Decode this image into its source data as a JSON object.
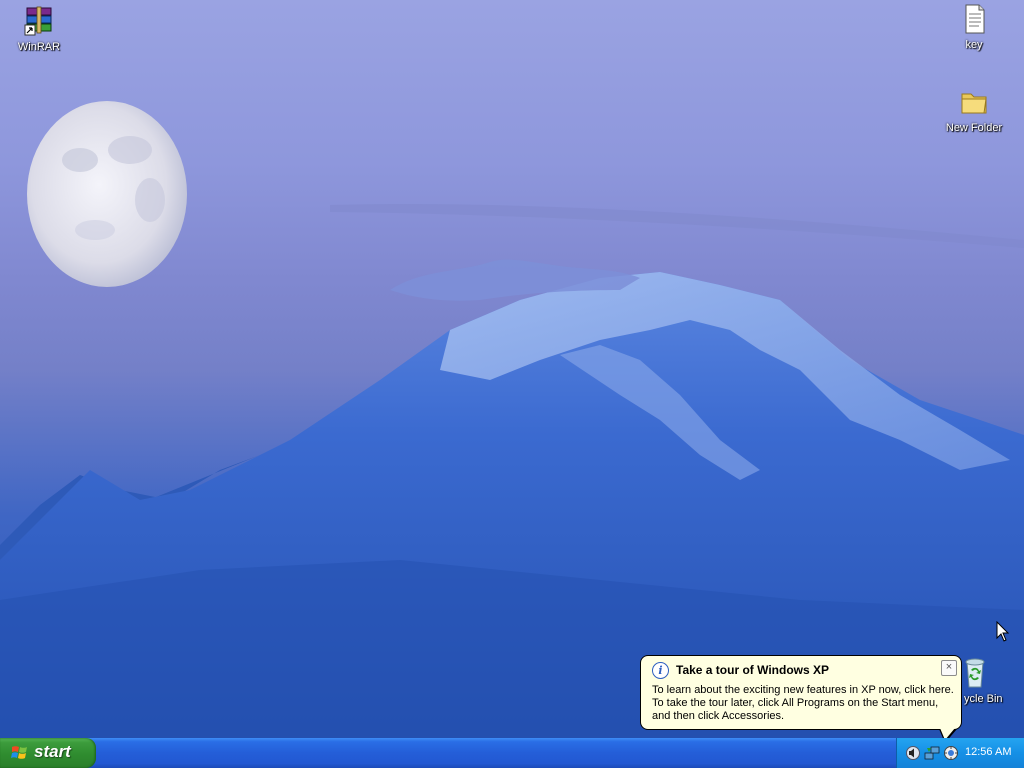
{
  "desktop": {
    "icons": [
      {
        "label": "WinRAR"
      },
      {
        "label": "key"
      },
      {
        "label": "New Folder"
      },
      {
        "label": "ycle Bin"
      }
    ]
  },
  "balloon": {
    "title": "Take a tour of Windows XP",
    "info_glyph": "i",
    "close_glyph": "×",
    "lines": [
      "To learn about the exciting new features in XP now, click here.",
      "To take the tour later, click All Programs on the Start menu,",
      "and then click Accessories."
    ]
  },
  "taskbar": {
    "start_label": "start",
    "clock": "12:56 AM",
    "tray_icons": [
      "speaker-icon",
      "network-icon",
      "tour-icon"
    ]
  },
  "colors": {
    "taskbar_blue": "#245ed8",
    "start_green": "#3c9c3c",
    "tray_blue": "#1590e6",
    "balloon_bg": "#ffffe1"
  }
}
